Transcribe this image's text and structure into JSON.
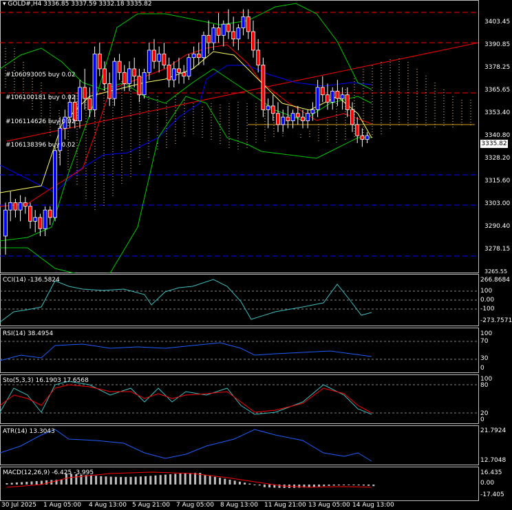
{
  "header": {
    "symbol_line": "GOLD#,H4  3336.85 3337.59 3332.18 3335.82"
  },
  "price_axis": [
    "3403.45",
    "3390.85",
    "3378.25",
    "3365.65",
    "3353.40",
    "3340.80",
    "3328.20",
    "3315.60",
    "3303.00",
    "3290.40",
    "3278.15",
    "3265.55"
  ],
  "current_price": "3335.82",
  "orders": [
    "#106093005 buy 0.02",
    "#106100181 buy 0.02",
    "#106114626 buy 0.02",
    "#106138396 buy 0.02"
  ],
  "indicators": {
    "cci": {
      "label": "CCI(14) -136.5824",
      "axis": [
        "266.8684",
        "100",
        "0.00",
        "-100",
        "-273.7571"
      ]
    },
    "rsi": {
      "label": "RSI(14) 38.4954",
      "axis": [
        "100",
        "70",
        "30",
        "0"
      ]
    },
    "sto": {
      "label": "Sto(5,3,3) 16.1903 17.6568",
      "axis": [
        "100",
        "80",
        "20",
        "0"
      ]
    },
    "atr": {
      "label": "ATR(14) 13.3043",
      "axis": [
        "21.7924",
        "12.7048"
      ]
    },
    "macd": {
      "label": "MACD(12,26,9) -6.425 -3.995",
      "axis": [
        "16.435",
        "0.00",
        "-17.405"
      ]
    }
  },
  "time_axis": [
    "30 Jul 2025",
    "1 Aug 05:00",
    "4 Aug 13:00",
    "5 Aug 21:00",
    "7 Aug 05:00",
    "8 Aug 13:00",
    "11 Aug 21:00",
    "13 Aug 05:00",
    "14 Aug 13:00"
  ],
  "colors": {
    "bull": "#ffffff",
    "bear": "#ff0000",
    "up_candle_body": "#0000ff"
  },
  "chart_data": {
    "type": "candlestick",
    "ylim": [
      3265.55,
      3409
    ],
    "candles": [
      [
        3282,
        3300,
        3272,
        3296
      ],
      [
        3296,
        3306,
        3290,
        3300
      ],
      [
        3300,
        3302,
        3292,
        3296
      ],
      [
        3296,
        3304,
        3290,
        3300
      ],
      [
        3300,
        3303,
        3294,
        3298
      ],
      [
        3298,
        3300,
        3286,
        3290
      ],
      [
        3290,
        3296,
        3284,
        3292
      ],
      [
        3292,
        3294,
        3282,
        3286
      ],
      [
        3286,
        3298,
        3282,
        3296
      ],
      [
        3296,
        3298,
        3288,
        3292
      ],
      [
        3292,
        3330,
        3290,
        3328
      ],
      [
        3328,
        3346,
        3320,
        3340
      ],
      [
        3340,
        3350,
        3334,
        3346
      ],
      [
        3346,
        3358,
        3340,
        3354
      ],
      [
        3354,
        3358,
        3340,
        3344
      ],
      [
        3344,
        3366,
        3340,
        3362
      ],
      [
        3362,
        3372,
        3350,
        3356
      ],
      [
        3356,
        3362,
        3346,
        3350
      ],
      [
        3350,
        3384,
        3346,
        3380
      ],
      [
        3380,
        3386,
        3368,
        3372
      ],
      [
        3372,
        3376,
        3360,
        3364
      ],
      [
        3364,
        3370,
        3352,
        3356
      ],
      [
        3356,
        3378,
        3352,
        3376
      ],
      [
        3376,
        3380,
        3366,
        3370
      ],
      [
        3370,
        3374,
        3360,
        3364
      ],
      [
        3364,
        3376,
        3360,
        3372
      ],
      [
        3372,
        3378,
        3362,
        3368
      ],
      [
        3368,
        3372,
        3354,
        3358
      ],
      [
        3358,
        3372,
        3356,
        3370
      ],
      [
        3370,
        3386,
        3366,
        3382
      ],
      [
        3382,
        3388,
        3372,
        3376
      ],
      [
        3376,
        3384,
        3370,
        3380
      ],
      [
        3380,
        3386,
        3372,
        3374
      ],
      [
        3374,
        3378,
        3362,
        3366
      ],
      [
        3366,
        3376,
        3362,
        3372
      ],
      [
        3372,
        3378,
        3364,
        3370
      ],
      [
        3370,
        3374,
        3364,
        3368
      ],
      [
        3368,
        3380,
        3366,
        3378
      ],
      [
        3378,
        3384,
        3372,
        3380
      ],
      [
        3380,
        3386,
        3374,
        3378
      ],
      [
        3378,
        3392,
        3374,
        3390
      ],
      [
        3390,
        3398,
        3380,
        3386
      ],
      [
        3386,
        3396,
        3382,
        3394
      ],
      [
        3394,
        3402,
        3386,
        3390
      ],
      [
        3390,
        3398,
        3384,
        3396
      ],
      [
        3396,
        3404,
        3388,
        3392
      ],
      [
        3392,
        3400,
        3384,
        3388
      ],
      [
        3388,
        3396,
        3382,
        3394
      ],
      [
        3394,
        3404,
        3390,
        3400
      ],
      [
        3400,
        3404,
        3388,
        3392
      ],
      [
        3392,
        3398,
        3378,
        3382
      ],
      [
        3382,
        3388,
        3370,
        3374
      ],
      [
        3374,
        3378,
        3346,
        3350
      ],
      [
        3350,
        3356,
        3340,
        3352
      ],
      [
        3352,
        3358,
        3344,
        3348
      ],
      [
        3348,
        3354,
        3338,
        3342
      ],
      [
        3342,
        3350,
        3338,
        3346
      ],
      [
        3346,
        3352,
        3340,
        3344
      ],
      [
        3344,
        3350,
        3340,
        3348
      ],
      [
        3348,
        3352,
        3342,
        3346
      ],
      [
        3346,
        3350,
        3340,
        3344
      ],
      [
        3344,
        3350,
        3340,
        3348
      ],
      [
        3348,
        3354,
        3344,
        3350
      ],
      [
        3350,
        3366,
        3346,
        3362
      ],
      [
        3362,
        3368,
        3354,
        3358
      ],
      [
        3358,
        3364,
        3350,
        3354
      ],
      [
        3354,
        3362,
        3350,
        3360
      ],
      [
        3360,
        3366,
        3352,
        3356
      ],
      [
        3356,
        3362,
        3350,
        3358
      ],
      [
        3358,
        3362,
        3346,
        3350
      ],
      [
        3350,
        3354,
        3338,
        3342
      ],
      [
        3342,
        3346,
        3332,
        3336
      ],
      [
        3336,
        3340,
        3330,
        3334
      ],
      [
        3334,
        3338,
        3332,
        3336
      ]
    ]
  }
}
